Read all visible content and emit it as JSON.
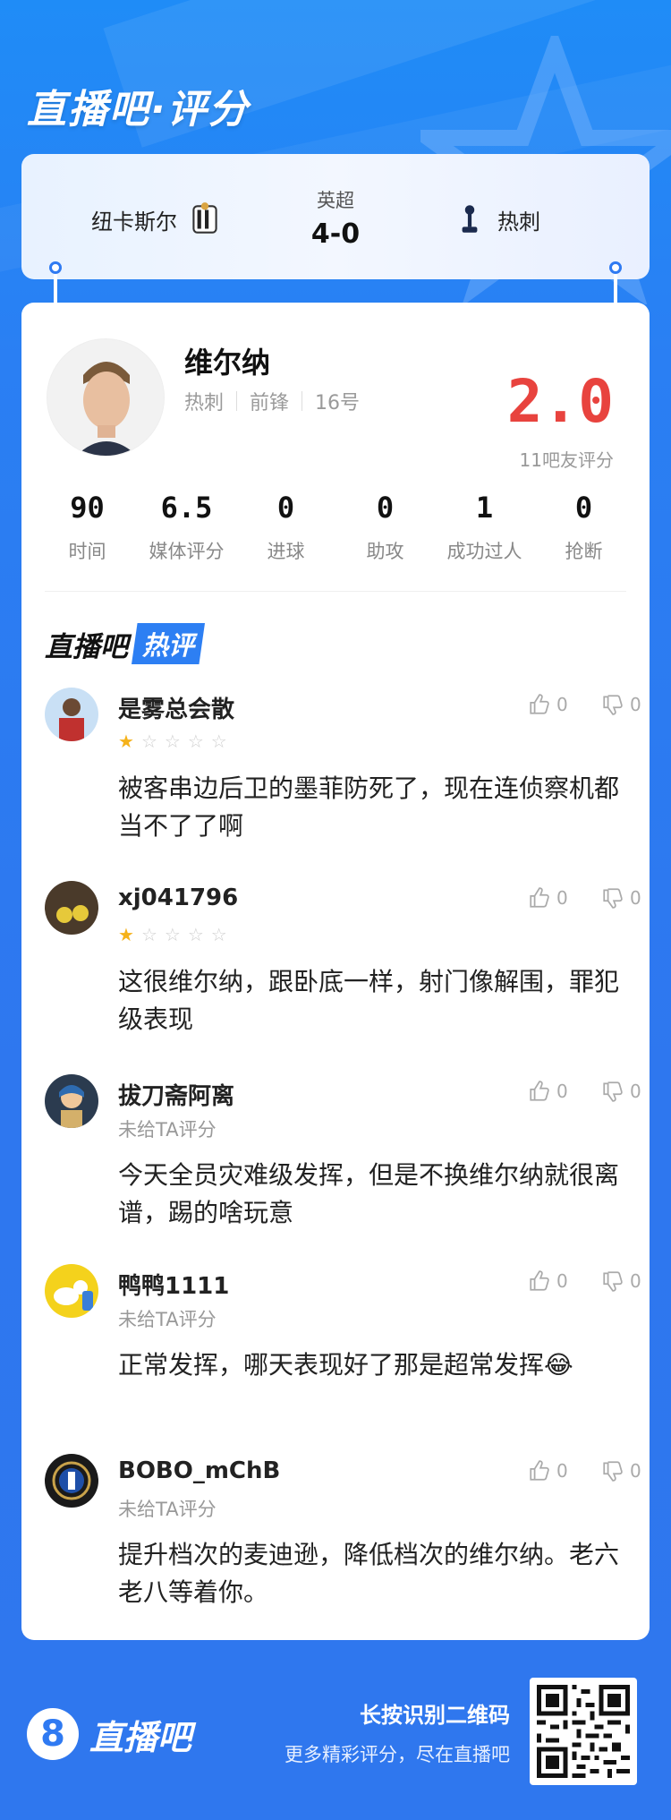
{
  "header": {
    "title": "直播吧·评分"
  },
  "match": {
    "home_team": "纽卡斯尔",
    "away_team": "热刺",
    "league": "英超",
    "score": "4-0"
  },
  "player": {
    "name": "维尔纳",
    "team": "热刺",
    "position": "前锋",
    "number": "16号",
    "rating": "2.0",
    "rating_count": "11吧友评分"
  },
  "stats": [
    {
      "value": "90",
      "label": "时间"
    },
    {
      "value": "6.5",
      "label": "媒体评分"
    },
    {
      "value": "0",
      "label": "进球"
    },
    {
      "value": "0",
      "label": "助攻"
    },
    {
      "value": "1",
      "label": "成功过人"
    },
    {
      "value": "0",
      "label": "抢断"
    }
  ],
  "hot_section": {
    "prefix": "直播吧",
    "tag": "热评"
  },
  "comments": [
    {
      "user": "是雾总会散",
      "stars": 1,
      "rating_text": "",
      "text": "被客串边后卫的墨菲防死了，现在连侦察机都当不了了啊",
      "likes": "0",
      "dislikes": "0"
    },
    {
      "user": "xj041796",
      "stars": 1,
      "rating_text": "",
      "text": "这很维尔纳，跟卧底一样，射门像解围，罪犯级表现",
      "likes": "0",
      "dislikes": "0"
    },
    {
      "user": "拔刀斋阿离",
      "stars": 0,
      "rating_text": "未给TA评分",
      "text": "今天全员灾难级发挥，但是不换维尔纳就很离谱，踢的啥玩意",
      "likes": "0",
      "dislikes": "0"
    },
    {
      "user": "鸭鸭1111",
      "stars": 0,
      "rating_text": "未给TA评分",
      "text": "正常发挥，哪天表现好了那是超常发挥😂",
      "likes": "0",
      "dislikes": "0"
    },
    {
      "user": "BOBO_mChB",
      "stars": 0,
      "rating_text": "未给TA评分",
      "text": "提升档次的麦迪逊，降低档次的维尔纳。老六老八等着你。",
      "likes": "0",
      "dislikes": "0"
    }
  ],
  "footer": {
    "logo_glyph": "8",
    "logo_text": "直播吧",
    "cta": "长按识别二维码",
    "sub": "更多精彩评分，尽在直播吧"
  },
  "colors": {
    "accent": "#2f7af2",
    "rating": "#e8433e",
    "star": "#f5b21a"
  }
}
